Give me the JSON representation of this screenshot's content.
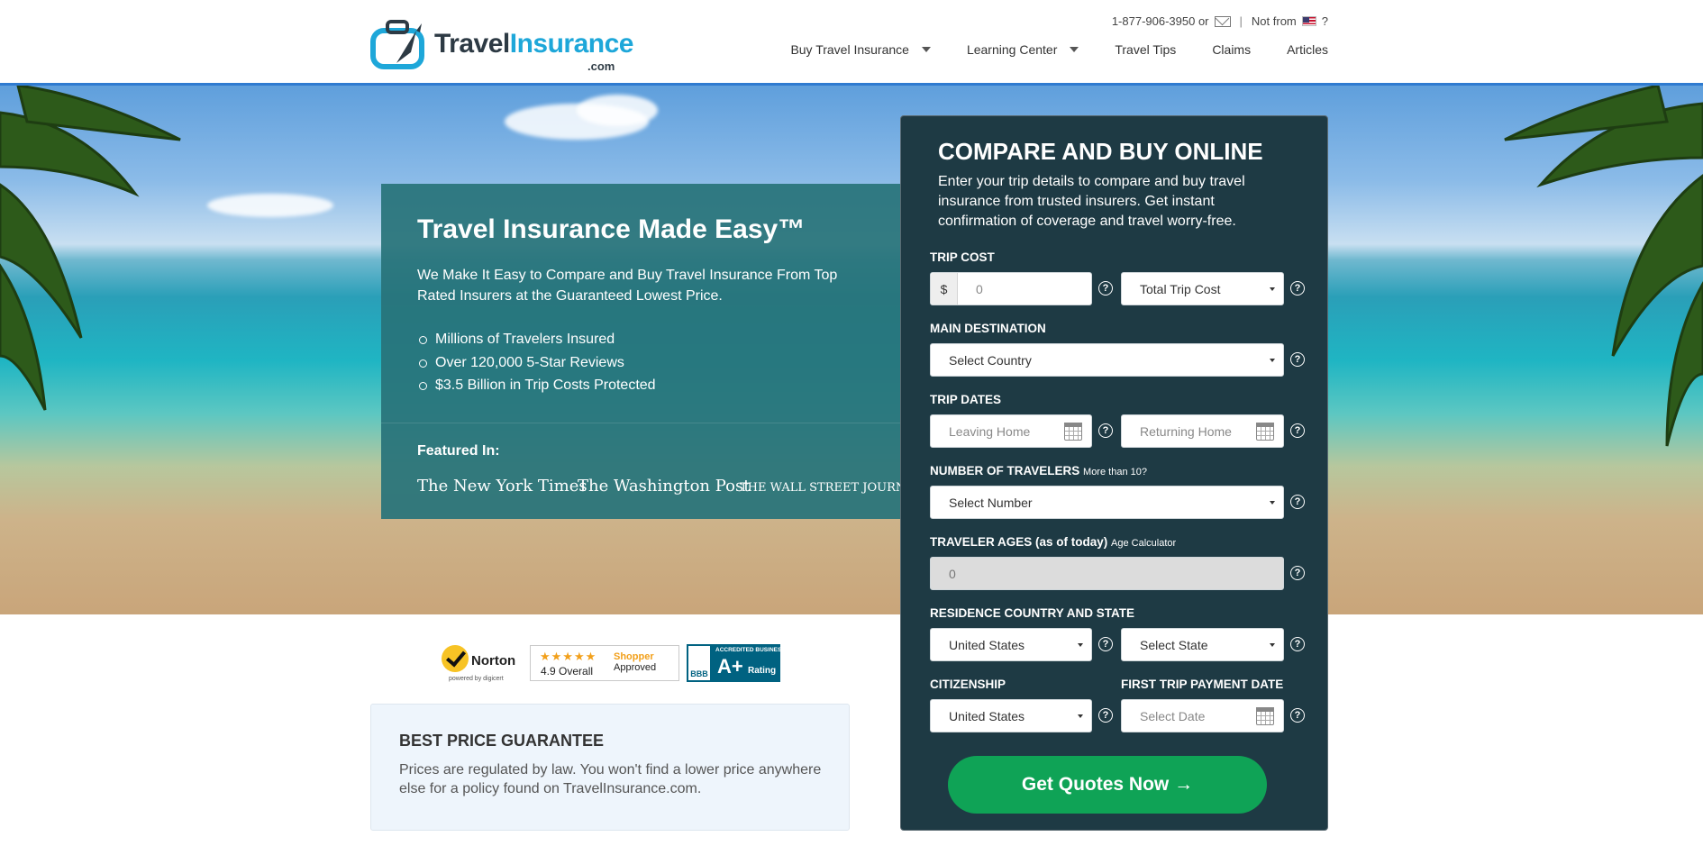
{
  "header": {
    "logo": {
      "word1": "Travel",
      "word2": "Insurance",
      "tld": ".com"
    },
    "phone": "1-877-906-3950 or",
    "not_from": "Not from",
    "question_mark": "?",
    "nav": [
      {
        "label": "Buy Travel Insurance",
        "has_dropdown": true
      },
      {
        "label": "Learning Center",
        "has_dropdown": true
      },
      {
        "label": "Travel Tips",
        "has_dropdown": false
      },
      {
        "label": "Claims",
        "has_dropdown": false
      },
      {
        "label": "Articles",
        "has_dropdown": false
      }
    ]
  },
  "hero": {
    "title": "Travel Insurance Made Easy™",
    "subtitle": "We Make It Easy to Compare and Buy Travel Insurance From Top Rated Insurers at the Guaranteed Lowest Price.",
    "bullets": [
      "Millions of Travelers Insured",
      "Over 120,000 5-Star Reviews",
      "$3.5 Billion in Trip Costs Protected"
    ],
    "featured_label": "Featured In:",
    "press": [
      "The New York Times",
      "The Washington Post",
      "THE WALL STREET JOURNAL."
    ]
  },
  "form": {
    "title": "COMPARE AND BUY ONLINE",
    "description": "Enter your trip details to compare and buy travel insurance from trusted insurers. Get instant confirmation of coverage and travel worry-free.",
    "trip_cost": {
      "label": "TRIP COST",
      "currency": "$",
      "placeholder": "0",
      "type_value": "Total Trip Cost"
    },
    "destination": {
      "label": "MAIN DESTINATION",
      "value": "Select Country"
    },
    "dates": {
      "label": "TRIP DATES",
      "leaving_placeholder": "Leaving Home",
      "returning_placeholder": "Returning Home"
    },
    "travelers": {
      "label": "NUMBER OF TRAVELERS",
      "hint": "More than 10?",
      "value": "Select Number"
    },
    "ages": {
      "label": "TRAVELER AGES (as of today)",
      "hint": "Age Calculator",
      "placeholder": "0"
    },
    "residence": {
      "label": "RESIDENCE COUNTRY AND STATE",
      "country": "United States",
      "state": "Select State"
    },
    "citizenship": {
      "label": "CITIZENSHIP",
      "value": "United States"
    },
    "payment": {
      "label": "FIRST TRIP PAYMENT DATE",
      "placeholder": "Select Date"
    },
    "help_glyph": "?",
    "cta": "Get Quotes Now →"
  },
  "trust": {
    "norton": {
      "name": "Norton",
      "powered": "powered by digicert"
    },
    "shopper": {
      "stars": "★★★★★",
      "overall": "4.9 Overall",
      "approved_line1": "Shopper",
      "approved_line2": "Approved"
    },
    "bbb": {
      "seal": "BBB",
      "accredited": "ACCREDITED BUSINESS",
      "grade": "A+",
      "rating": "Rating"
    }
  },
  "guarantee": {
    "title": "BEST PRICE GUARANTEE",
    "text": "Prices are regulated by law. You won't find a lower price anywhere else for a policy found on TravelInsurance.com."
  },
  "colors": {
    "brand_dark": "#2d3a44",
    "brand_blue": "#1ea7d9",
    "form_bg": "#1e3a44",
    "hero_panel": "#28737a",
    "cta_green": "#0fa356",
    "guarantee_bg": "#eef5fc"
  }
}
